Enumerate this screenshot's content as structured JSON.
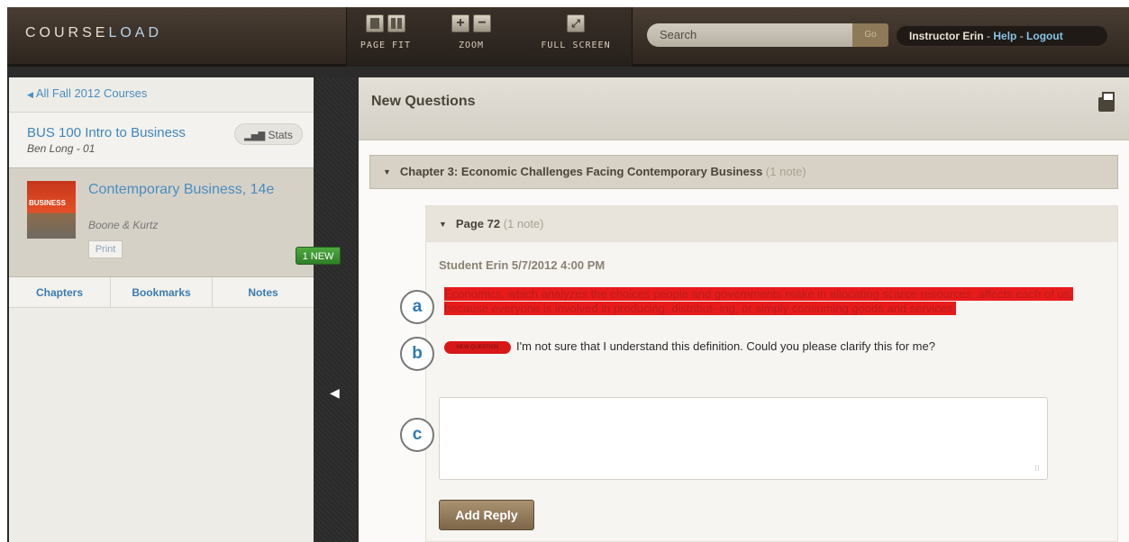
{
  "app": {
    "logo_a": "COURSE",
    "logo_b": "LOAD"
  },
  "toolbar": {
    "page_fit": "PAGE FIT",
    "zoom": "ZOOM",
    "full_screen": "FULL SCREEN",
    "zoom_in": "+",
    "zoom_out": "−"
  },
  "search": {
    "placeholder": "Search",
    "go": "Go"
  },
  "user": {
    "name": "Instructor Erin",
    "sep1": " - ",
    "help": "Help",
    "sep2": " - ",
    "logout": "Logout"
  },
  "left": {
    "back": "All Fall 2012 Courses",
    "course_title": "BUS 100 Intro to Business",
    "course_instructor": "Ben Long - 01",
    "stats": "Stats",
    "book_title": "Contemporary Business, 14e",
    "book_authors": "Boone & Kurtz",
    "book_cover_text": "BUSINESS",
    "print": "Print",
    "new_badge": "1 NEW",
    "tabs": [
      "Chapters",
      "Bookmarks",
      "Notes"
    ]
  },
  "main": {
    "title": "New Questions",
    "chapter": "Chapter 3: Economic Challenges Facing Contemporary Business",
    "chapter_count": "(1 note)",
    "page": "Page 72",
    "page_count": "(1 note)",
    "author_line": "Student Erin 5/7/2012 4:00 PM",
    "highlight": "Economics, which analyzes the choices people and governments make in allocating scarce resources, affects each of us, because everyone is involved in producing, distribut- ing, or simply consuming goods and services.",
    "question_badge": "NEW QUESTION",
    "question": "I'm not sure that I understand this definition. Could you please clarify this for me?",
    "add_reply": "Add Reply",
    "reply_value": ""
  },
  "callouts": [
    "a",
    "b",
    "c"
  ],
  "colors": {
    "accent": "#4a8ec0",
    "highlight": "#e81b1b",
    "new_badge": "#3c9433",
    "button": "#8e7554"
  }
}
